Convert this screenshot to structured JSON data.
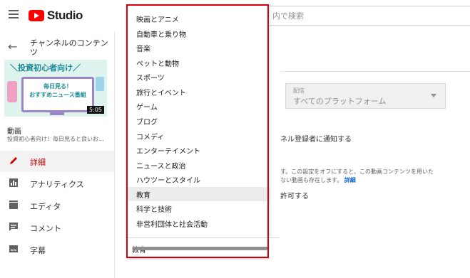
{
  "app": {
    "logo_text": "Studio"
  },
  "search": {
    "placeholder": "内で検索"
  },
  "sidebar": {
    "back_title": "チャンネルのコンテンツ",
    "thumbnail": {
      "banner": "＼投資初心者向け／",
      "screen_line1": "毎日見る！",
      "screen_line2": "おすすめニュース番組",
      "duration": "5:05"
    },
    "video_label": "動画",
    "video_desc": "投資初心者向け！毎日見ると良いお...",
    "items": [
      {
        "label": "詳細",
        "icon": "pencil-icon",
        "active": true
      },
      {
        "label": "アナリティクス",
        "icon": "analytics-icon"
      },
      {
        "label": "エディタ",
        "icon": "film-icon"
      },
      {
        "label": "コメント",
        "icon": "comment-icon"
      },
      {
        "label": "字幕",
        "icon": "subtitles-icon"
      }
    ]
  },
  "main": {
    "distribution": {
      "caption": "配信",
      "value": "すべてのプラットフォーム"
    },
    "notify_text": "ネル登録者に通知する",
    "info_text": "す。この設定をオフにすると、この動画コンテンツを用いた",
    "info_text2": "ない動画も存在します。",
    "info_link": "詳細",
    "allow_text": "許可する"
  },
  "dropdown": {
    "options": [
      "映画とアニメ",
      "自動車と乗り物",
      "音楽",
      "ペットと動物",
      "スポーツ",
      "旅行とイベント",
      "ゲーム",
      "ブログ",
      "コメディ",
      "エンターテイメント",
      "ニュースと政治",
      "ハウツーとスタイル",
      "教育",
      "科学と技術",
      "非営利団体と社会活動"
    ],
    "selected": "教育",
    "highlight_color": "#d8000c"
  }
}
